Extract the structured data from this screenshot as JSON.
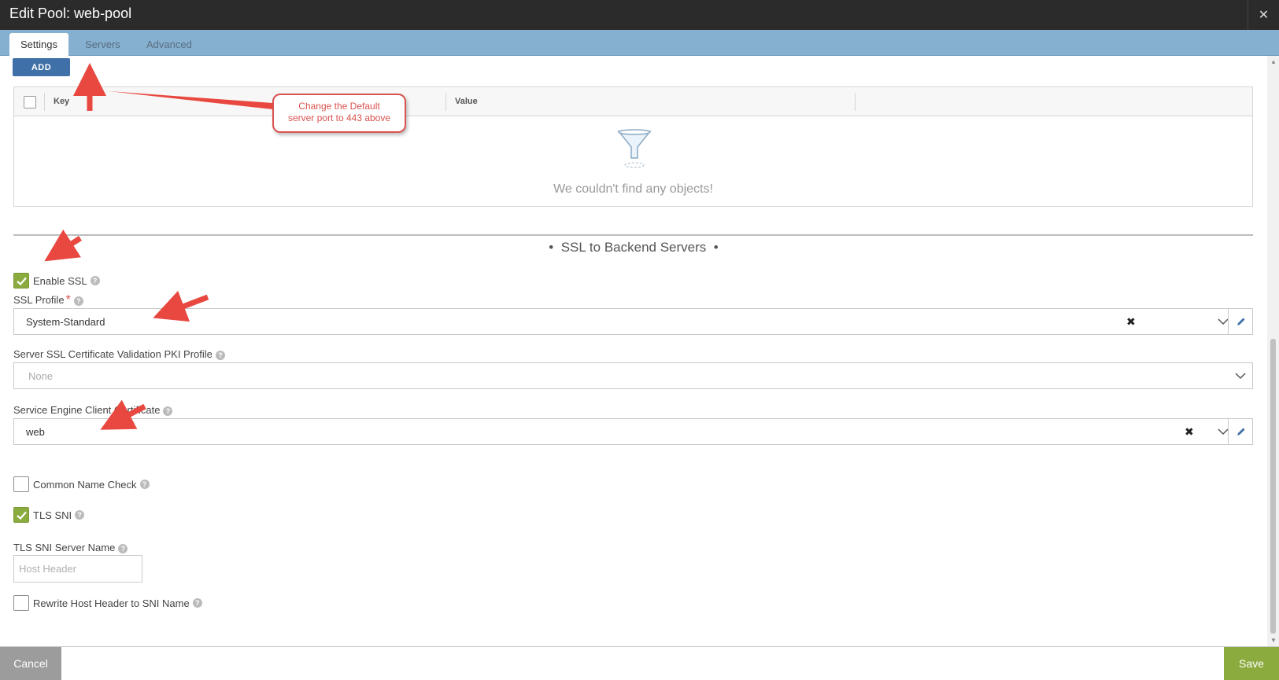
{
  "window": {
    "title": "Edit Pool: web-pool",
    "close_glyph": "✕"
  },
  "tabs": [
    {
      "label": "Settings",
      "active": true
    },
    {
      "label": "Servers",
      "active": false
    },
    {
      "label": "Advanced",
      "active": false
    }
  ],
  "add_button": {
    "label": "ADD"
  },
  "grid": {
    "columns": [
      "Key",
      "Value"
    ],
    "empty_message": "We couldn't find any objects!",
    "empty_icon": "funnel-icon"
  },
  "callout": {
    "line1": "Change the Default",
    "line2": "server port to 443 above"
  },
  "section": {
    "title": "SSL to Backend Servers"
  },
  "enable_ssl": {
    "label": "Enable SSL",
    "checked": true
  },
  "ssl_profile": {
    "label": "SSL Profile",
    "required_mark": "*",
    "value": "System-Standard"
  },
  "pki_profile": {
    "label": "Server SSL Certificate Validation PKI Profile",
    "placeholder": "None"
  },
  "client_cert": {
    "label": "Service Engine Client Certificate",
    "value": "web"
  },
  "common_name_check": {
    "label": "Common Name Check",
    "checked": false
  },
  "tls_sni": {
    "label": "TLS SNI",
    "checked": true
  },
  "tls_sni_server_name": {
    "label": "TLS SNI Server Name",
    "placeholder": "Host Header"
  },
  "rewrite_host_header": {
    "label": "Rewrite Host Header to SNI Name",
    "checked": false
  },
  "footer": {
    "cancel_label": "Cancel",
    "save_label": "Save"
  },
  "colors": {
    "accent_blue": "#3f70a8",
    "tab_bar": "#85b0cf",
    "check_green": "#8bab3f",
    "annotation_red": "#d9534f"
  }
}
